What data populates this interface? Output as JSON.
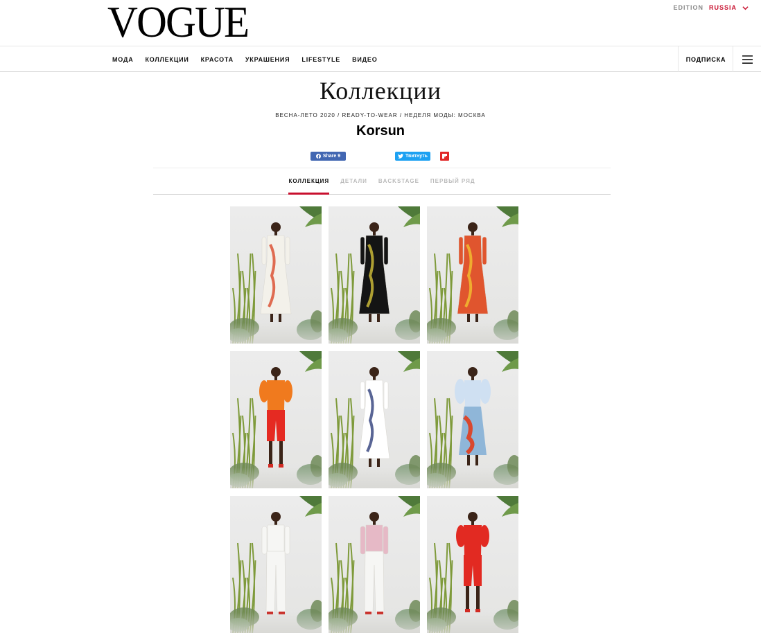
{
  "header": {
    "logo": "VOGUE",
    "edition_label": "EDITION",
    "edition_value": "RUSSIA"
  },
  "nav": {
    "items": [
      "МОДА",
      "КОЛЛЕКЦИИ",
      "КРАСОТА",
      "УКРАШЕНИЯ",
      "LIFESTYLE",
      "ВИДЕО"
    ],
    "subscribe": "ПОДПИСКА",
    "menu_icon": "hamburger-menu-icon"
  },
  "page": {
    "title": "Коллекции",
    "breadcrumb": "ВЕСНА-ЛЕТО 2020 / READY-TO-WEAR / НЕДЕЛЯ МОДЫ: МОСКВА",
    "designer": "Korsun"
  },
  "share": {
    "facebook_label": "Share 9",
    "twitter_label": "Твитнуть",
    "facebook_icon": "facebook-icon",
    "twitter_icon": "twitter-bird-icon",
    "flipboard_icon": "flipboard-icon"
  },
  "tabs": {
    "items": [
      "КОЛЛЕКЦИЯ",
      "ДЕТАЛИ",
      "BACKSTAGE",
      "ПЕРВЫЙ РЯД"
    ],
    "active_index": 0
  },
  "colors": {
    "accent": "#c8102e",
    "facebook": "#4267b2",
    "twitter": "#1da1f2",
    "flipboard": "#e12828"
  },
  "gallery": {
    "looks": [
      {
        "top": "#f3f1ea",
        "bottom": "#f3f1ea",
        "accent": "#d94a2a",
        "style": "dress"
      },
      {
        "top": "#141414",
        "bottom": "#141414",
        "accent": "#d4c23a",
        "style": "dress"
      },
      {
        "top": "#e0552e",
        "bottom": "#3a8a5c",
        "accent": "#f2c230",
        "style": "dress"
      },
      {
        "top": "#f07a1e",
        "bottom": "#e52a22",
        "accent": "#e52a22",
        "style": "shorts"
      },
      {
        "top": "#ffffff",
        "bottom": "#c9443a",
        "accent": "#2f3e7a",
        "style": "dress"
      },
      {
        "top": "#cfe0f2",
        "bottom": "#8fb6d8",
        "accent": "#d9482e",
        "style": "skirt"
      },
      {
        "top": "#f6f6f4",
        "bottom": "#f6f6f4",
        "accent": "#d8d8d4",
        "style": "pants"
      },
      {
        "top": "#e6b9c6",
        "bottom": "#f6f6f4",
        "accent": "#2e5f8a",
        "style": "pants"
      },
      {
        "top": "#e22a22",
        "bottom": "#e22a22",
        "accent": "#b81e18",
        "style": "shorts"
      }
    ]
  }
}
